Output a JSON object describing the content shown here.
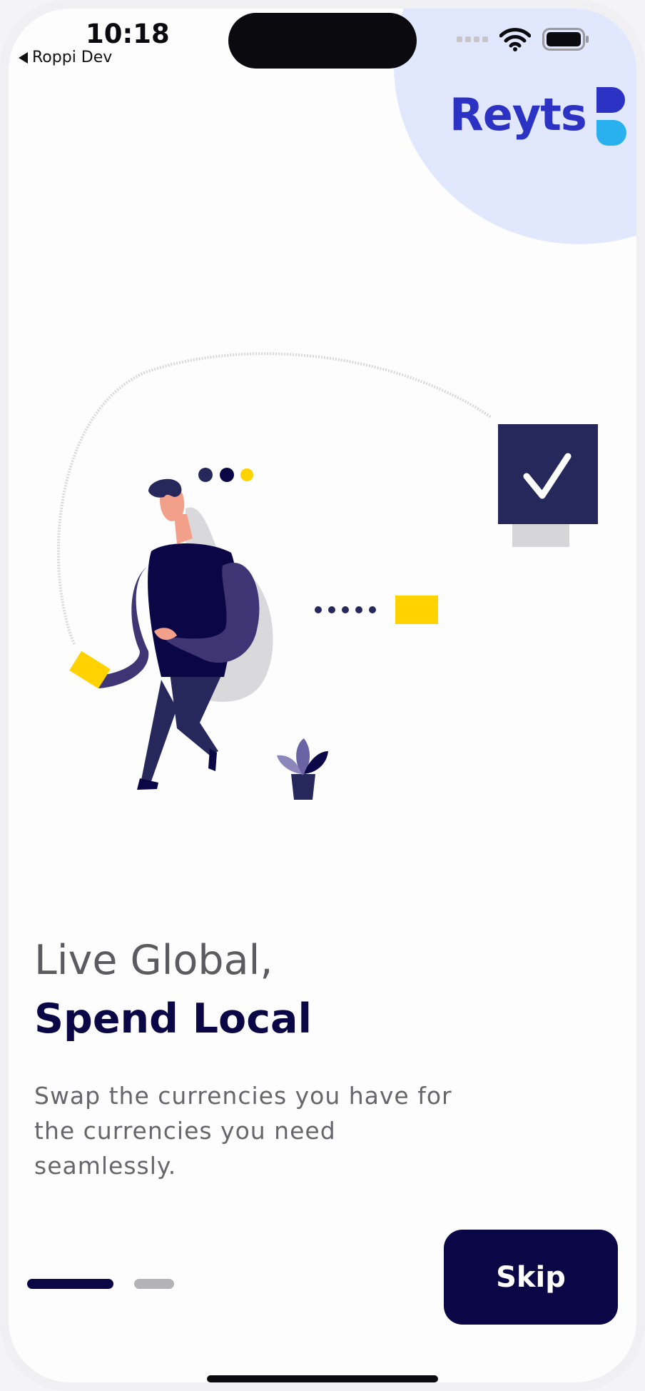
{
  "status_bar": {
    "time": "10:18",
    "back_label": "Roppi Dev"
  },
  "brand": {
    "name": "Reyts",
    "colors": {
      "primary": "#2c32c4",
      "accent_cyan": "#29b0ee",
      "navy": "#0b0645",
      "yellow": "#ffd200",
      "blob": "#e1e8fd"
    }
  },
  "illustration": {
    "icon": "person-sending-money-illustration"
  },
  "headline": {
    "line1": "Live Global,",
    "line2": "Spend Local"
  },
  "description": "Swap the currencies you have for the currencies you need seamlessly.",
  "pagination": {
    "current_page": 1,
    "total_pages": 2
  },
  "actions": {
    "skip_label": "Skip"
  }
}
